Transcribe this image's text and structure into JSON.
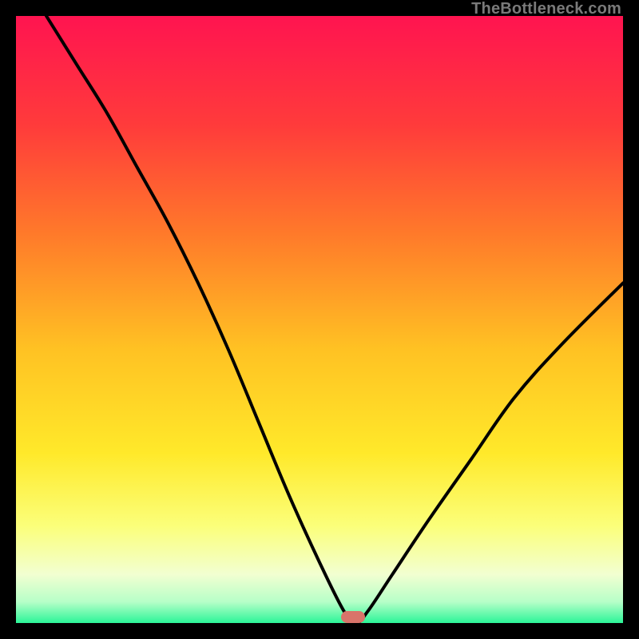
{
  "watermark": "TheBottleneck.com",
  "colors": {
    "curve": "#000000",
    "marker": "#d9746a",
    "gradient_stops": [
      {
        "offset": 0.0,
        "color": "#ff1450"
      },
      {
        "offset": 0.18,
        "color": "#ff3b3b"
      },
      {
        "offset": 0.36,
        "color": "#ff7a2a"
      },
      {
        "offset": 0.55,
        "color": "#ffc223"
      },
      {
        "offset": 0.72,
        "color": "#ffe92a"
      },
      {
        "offset": 0.84,
        "color": "#fbff7a"
      },
      {
        "offset": 0.92,
        "color": "#f2ffd1"
      },
      {
        "offset": 0.965,
        "color": "#b7ffc8"
      },
      {
        "offset": 1.0,
        "color": "#2bf598"
      }
    ]
  },
  "chart_data": {
    "type": "line",
    "title": "",
    "xlabel": "",
    "ylabel": "",
    "xlim": [
      0,
      100
    ],
    "ylim": [
      0,
      100
    ],
    "grid": false,
    "legend": false,
    "marker": {
      "x": 55.5,
      "y": 0,
      "width_x": 4,
      "height_y": 2
    },
    "series": [
      {
        "name": "bottleneck-curve",
        "x": [
          5,
          10,
          15,
          20,
          25,
          30,
          35,
          40,
          45,
          50,
          54,
          56,
          58,
          62,
          68,
          75,
          82,
          90,
          100
        ],
        "y": [
          100,
          92,
          84,
          75,
          66,
          56,
          45,
          33,
          21,
          10,
          2,
          0,
          2,
          8,
          17,
          27,
          37,
          46,
          56
        ]
      }
    ]
  }
}
